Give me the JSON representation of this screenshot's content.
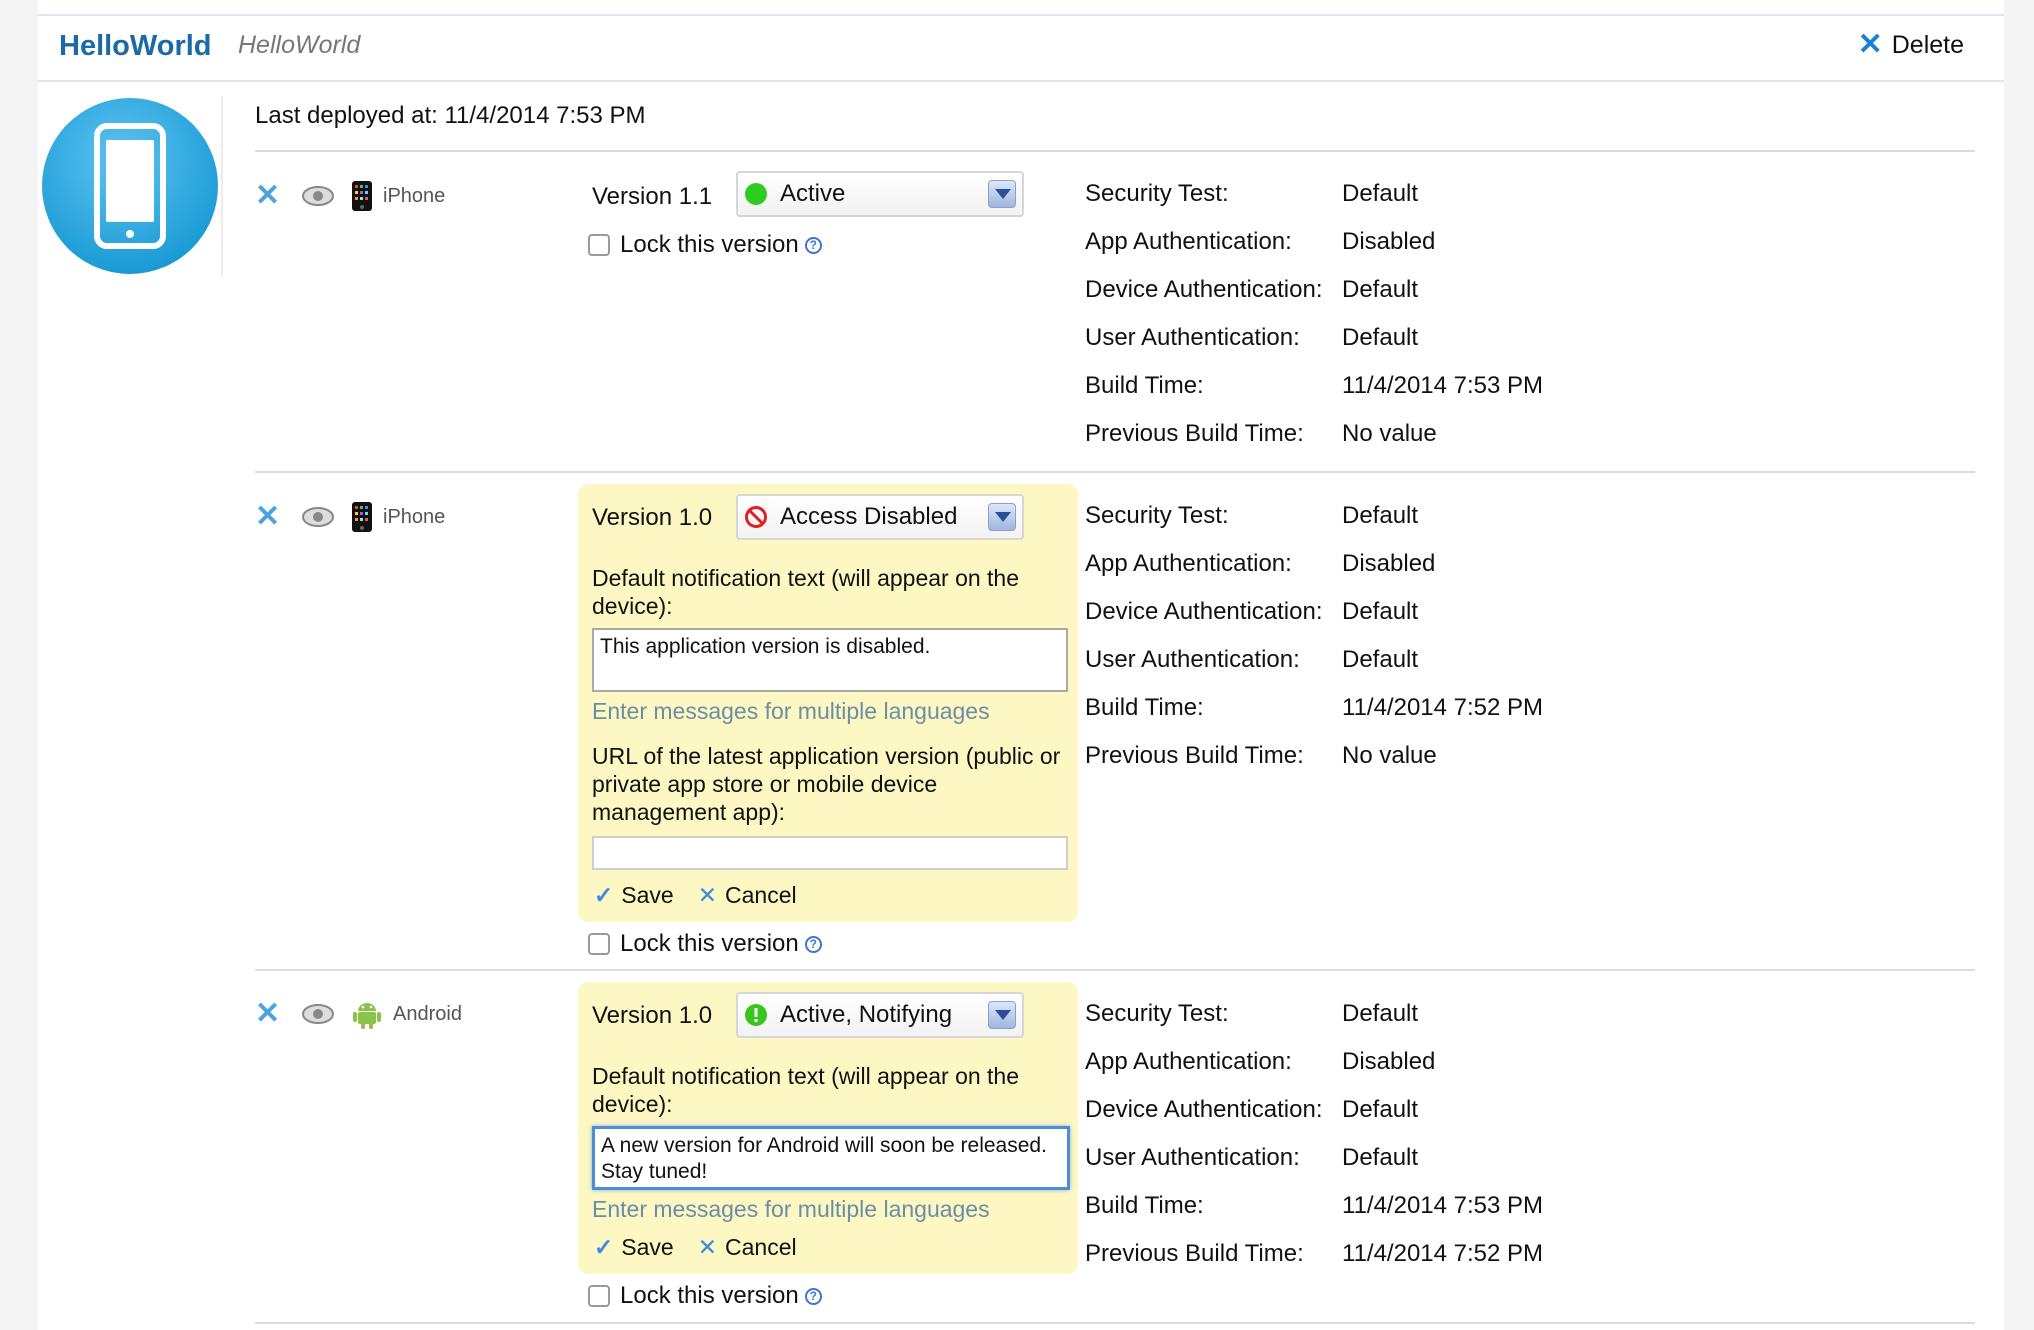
{
  "header": {
    "app_name": "HelloWorld",
    "app_subtitle": "HelloWorld",
    "delete_label": "Delete"
  },
  "last_deployed": "Last deployed at: 11/4/2014 7:53 PM",
  "lock_label": "Lock this version",
  "help_glyph": "?",
  "save_label": "Save",
  "cancel_label": "Cancel",
  "notification_label": "Default notification text (will appear on the device):",
  "multi_lang_link": "Enter messages for multiple languages",
  "url_label": "URL of the latest application version (public or private app store or mobile device management app):",
  "property_labels": {
    "security_test": "Security Test:",
    "app_auth": "App Authentication:",
    "device_auth": "Device Authentication:",
    "user_auth": "User Authentication:",
    "build_time": "Build Time:",
    "prev_build_time": "Previous Build Time:"
  },
  "versions": [
    {
      "platform": "iPhone",
      "platform_icon": "iphone-device-icon",
      "version": "Version 1.1",
      "status": "Active",
      "status_icon": "green-dot-icon",
      "status_color": "#2ecc1e",
      "notification_text": "",
      "url_value": "",
      "props": {
        "security_test": "Default",
        "app_auth": "Disabled",
        "device_auth": "Default",
        "user_auth": "Default",
        "build_time": "11/4/2014 7:53 PM",
        "prev_build_time": "No value"
      }
    },
    {
      "platform": "iPhone",
      "platform_icon": "iphone-device-icon",
      "version": "Version 1.0",
      "status": "Access Disabled",
      "status_icon": "no-entry-icon",
      "status_color": "#e02020",
      "notification_text": "This application version is disabled.",
      "url_value": "",
      "props": {
        "security_test": "Default",
        "app_auth": "Disabled",
        "device_auth": "Default",
        "user_auth": "Default",
        "build_time": "11/4/2014 7:52 PM",
        "prev_build_time": "No value"
      }
    },
    {
      "platform": "Android",
      "platform_icon": "android-robot-icon",
      "version": "Version 1.0",
      "status": "Active, Notifying",
      "status_icon": "exclamation-circle-icon",
      "status_color": "#38c61c",
      "notification_text": "A new version for Android will soon be released. Stay tuned!",
      "url_value": "",
      "props": {
        "security_test": "Default",
        "app_auth": "Disabled",
        "device_auth": "Default",
        "user_auth": "Default",
        "build_time": "11/4/2014 7:53 PM",
        "prev_build_time": "11/4/2014 7:52 PM"
      }
    }
  ],
  "colors": {
    "brand": "#1b6aa5",
    "accent_blue": "#1a82d6",
    "edit_panel": "#fdf7c3",
    "link": "#6b8ea7"
  }
}
